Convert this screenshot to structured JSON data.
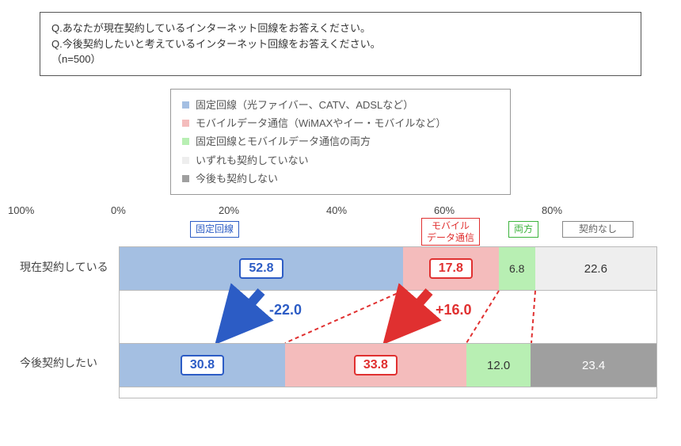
{
  "question": {
    "line1": "Q.あなたが現在契約しているインターネット回線をお答えください。",
    "line2": "Q.今後契約したいと考えているインターネット回線をお答えください。",
    "n": "（n=500）"
  },
  "legend": {
    "items": [
      {
        "label": "固定回線（光ファイバー、CATV、ADSLなど）",
        "color": "#a4bfe2"
      },
      {
        "label": "モバイルデータ通信（WiMAXやイー・モバイルなど）",
        "color": "#f4bcbc"
      },
      {
        "label": "固定回線とモバイルデータ通信の両方",
        "color": "#b8efb3"
      },
      {
        "label": "いずれも契約していない",
        "color": "#eeeeee"
      },
      {
        "label": "今後も契約しない",
        "color": "#9f9f9f"
      }
    ]
  },
  "axis": [
    "0%",
    "20%",
    "40%",
    "60%",
    "80%",
    "100%"
  ],
  "rows": {
    "current": {
      "label": "現在契約している",
      "fixed": "52.8",
      "mobile": "17.8",
      "both": "6.8",
      "none": "22.6"
    },
    "future": {
      "label": "今後契約したい",
      "fixed": "30.8",
      "mobile": "33.8",
      "both": "12.0",
      "none": "23.4"
    }
  },
  "annotations": {
    "fixed": "固定回線",
    "mobile": "モバイル\nデータ通信",
    "both": "両方",
    "none": "契約なし",
    "delta_fixed": "-22.0",
    "delta_mobile": "+16.0"
  },
  "chart_data": {
    "type": "bar",
    "orientation": "horizontal-stacked",
    "title": "インターネット回線の現在契約と今後契約意向",
    "xlabel": "",
    "ylabel": "",
    "xlim": [
      0,
      100
    ],
    "unit": "%",
    "categories": [
      "現在契約している",
      "今後契約したい"
    ],
    "series": [
      {
        "name": "固定回線（光ファイバー、CATV、ADSLなど）",
        "values": [
          52.8,
          30.8
        ],
        "color": "#a4bfe2"
      },
      {
        "name": "モバイルデータ通信（WiMAXやイー・モバイルなど）",
        "values": [
          17.8,
          33.8
        ],
        "color": "#f4bcbc"
      },
      {
        "name": "固定回線とモバイルデータ通信の両方",
        "values": [
          6.8,
          12.0
        ],
        "color": "#b8efb3"
      },
      {
        "name": "いずれも契約していない",
        "values": [
          22.6,
          null
        ],
        "color": "#eeeeee"
      },
      {
        "name": "今後も契約しない",
        "values": [
          null,
          23.4
        ],
        "color": "#9f9f9f"
      }
    ],
    "deltas": [
      {
        "series": "固定回線",
        "value": -22.0
      },
      {
        "series": "モバイルデータ通信",
        "value": 16.0
      }
    ],
    "n": 500
  }
}
